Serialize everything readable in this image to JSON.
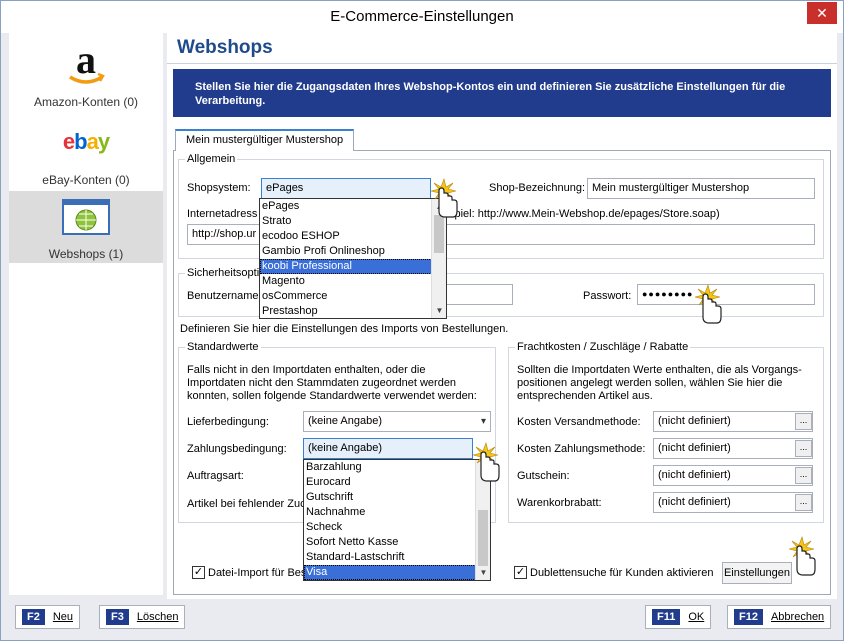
{
  "window": {
    "title": "E-Commerce-Einstellungen"
  },
  "sidebar": {
    "items": [
      {
        "label": "Amazon-Konten (0)",
        "icon": "amazon-logo-icon"
      },
      {
        "label": "eBay-Konten (0)",
        "logo_text": "ebay",
        "icon": "ebay-logo-icon"
      },
      {
        "label": "Webshops (1)",
        "icon": "globe-window-icon",
        "active": true
      }
    ]
  },
  "page": {
    "title": "Webshops",
    "info": "Stellen Sie hier die Zugangsdaten Ihres Webshop-Kontos ein und definieren Sie zusätzliche Einstellungen für die Verarbeitung.",
    "tab_label": "Mein mustergültiger Mustershop"
  },
  "allgemein": {
    "group_label": "Allgemein",
    "shopsystem_label": "Shopsystem:",
    "shopsystem_value": "ePages",
    "shopsystem_options": [
      "ePages",
      "Strato",
      "ecodoo ESHOP",
      "Gambio Profi Onlineshop",
      "koobi Professional",
      "Magento",
      "osCommerce",
      "Prestashop"
    ],
    "shopsystem_highlighted": "koobi Professional",
    "bezeichnung_label": "Shop-Bezeichnung:",
    "bezeichnung_value": "Mein mustergültiger Mustershop",
    "internetadresse_label": "Internetadress",
    "example_text": "spiel: http://www.Mein-Webshop.de/epages/Store.soap)",
    "url_value": "http://shop.ur"
  },
  "sicherheit": {
    "group_label": "Sicherheitsoptio",
    "benutzer_label": "Benutzername:",
    "passwort_label": "Passwort:",
    "passwort_value": "●●●●●●●●"
  },
  "import_text": "Definieren Sie hier die Einstellungen des Imports von Bestellungen.",
  "standardwerte": {
    "group_label": "Standardwerte",
    "description": "Falls nicht in den Importdaten enthalten, oder die Importdaten nicht den Stammdaten zugeordnet werden konnten, sollen folgende Standardwerte verwendet werden:",
    "liefer_label": "Lieferbedingung:",
    "liefer_value": "(keine Angabe)",
    "zahlung_label": "Zahlungsbedingung:",
    "zahlung_value": "(keine Angabe)",
    "zahlung_options": [
      "Barzahlung",
      "Eurocard",
      "Gutschrift",
      "Nachnahme",
      "Scheck",
      "Sofort Netto Kasse",
      "Standard-Lastschrift",
      "Visa"
    ],
    "zahlung_highlighted": "Visa",
    "auftragsart_label": "Auftragsart:",
    "artikel_label": "Artikel bei fehlender Zuc"
  },
  "fracht": {
    "group_label": "Frachtkosten / Zuschläge / Rabatte",
    "description": "Sollten die Importdaten Werte enthalten, die als Vorgangs-positionen angelegt werden sollen, wählen Sie hier die entsprechenden Artikel aus.",
    "rows": [
      {
        "label": "Kosten Versandmethode:",
        "value": "(nicht definiert)"
      },
      {
        "label": "Kosten Zahlungsmethode:",
        "value": "(nicht definiert)"
      },
      {
        "label": "Gutschein:",
        "value": "(nicht definiert)"
      },
      {
        "label": "Warenkorbrabatt:",
        "value": "(nicht definiert)"
      }
    ],
    "dots_label": "..."
  },
  "options": {
    "datei_import_label": "Datei-Import für Bes",
    "dubletten_label": "Dublettensuche für Kunden aktivieren",
    "einstellungen_label": "Einstellungen"
  },
  "footer": {
    "neu_key": "F2",
    "neu_label": "Neu",
    "loeschen_key": "F3",
    "loeschen_label": "Löschen",
    "ok_key": "F11",
    "ok_label": "OK",
    "abbrechen_key": "F12",
    "abbrechen_label": "Abbrechen"
  },
  "colors": {
    "accent": "#213c8c",
    "title_blue": "#1f4b8b",
    "close_red": "#c9302c",
    "selection": "#3b6fd8"
  }
}
